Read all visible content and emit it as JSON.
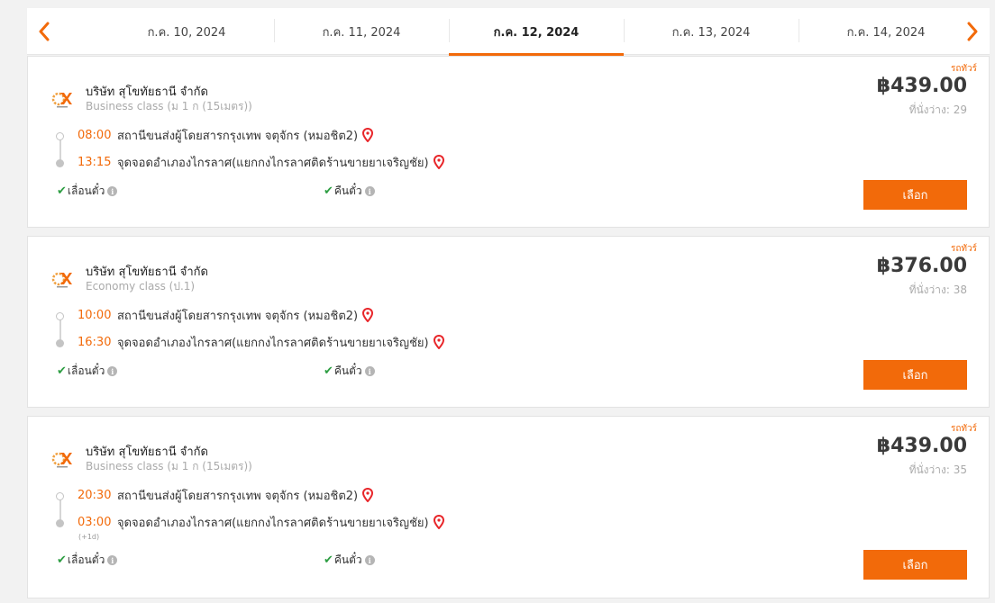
{
  "date_nav": {
    "prev_icon": "chevron-left-icon",
    "next_icon": "chevron-right-icon",
    "accent_color": "#f26a0a",
    "dates": [
      {
        "label": "ก.ค. 10, 2024",
        "active": false
      },
      {
        "label": "ก.ค. 11, 2024",
        "active": false
      },
      {
        "label": "ก.ค. 12, 2024",
        "active": true
      },
      {
        "label": "ก.ค. 13, 2024",
        "active": false
      },
      {
        "label": "ก.ค. 14, 2024",
        "active": false
      }
    ]
  },
  "trips": [
    {
      "tag": "รถทัวร์",
      "company": "บริษัท สุโขทัยธานี จำกัด",
      "bus_class": "Business class (ม 1 ก (15เมตร))",
      "price": "฿439.00",
      "seats": "ที่นั่งว่าง: 29",
      "departure_time": "08:00",
      "departure_place": "สถานีขนส่งผู้โดยสารกรุงเทพ จตุจักร (หมอชิต2)",
      "arrival_time": "13:15",
      "arrival_place": "จุดจอดอำเภองไกรลาศ(แยกกงไกรลาศติดร้านขายยาเจริญชัย)",
      "arrival_day_offset": "",
      "policy_reschedule": "เลื่อนตั๋ว",
      "policy_refund": "คืนตั๋ว",
      "select_label": "เลือก"
    },
    {
      "tag": "รถทัวร์",
      "company": "บริษัท สุโขทัยธานี จำกัด",
      "bus_class": "Economy class (ป.1)",
      "price": "฿376.00",
      "seats": "ที่นั่งว่าง: 38",
      "departure_time": "10:00",
      "departure_place": "สถานีขนส่งผู้โดยสารกรุงเทพ จตุจักร (หมอชิต2)",
      "arrival_time": "16:30",
      "arrival_place": "จุดจอดอำเภองไกรลาศ(แยกกงไกรลาศติดร้านขายยาเจริญชัย)",
      "arrival_day_offset": "",
      "policy_reschedule": "เลื่อนตั๋ว",
      "policy_refund": "คืนตั๋ว",
      "select_label": "เลือก"
    },
    {
      "tag": "รถทัวร์",
      "company": "บริษัท สุโขทัยธานี จำกัด",
      "bus_class": "Business class (ม 1 ก (15เมตร))",
      "price": "฿439.00",
      "seats": "ที่นั่งว่าง: 35",
      "departure_time": "20:30",
      "departure_place": "สถานีขนส่งผู้โดยสารกรุงเทพ จตุจักร (หมอชิต2)",
      "arrival_time": "03:00",
      "arrival_place": "จุดจอดอำเภองไกรลาศ(แยกกงไกรลาศติดร้านขายยาเจริญชัย)",
      "arrival_day_offset": "(+1d)",
      "policy_reschedule": "เลื่อนตั๋ว",
      "policy_refund": "คืนตั๋ว",
      "select_label": "เลือก"
    }
  ]
}
